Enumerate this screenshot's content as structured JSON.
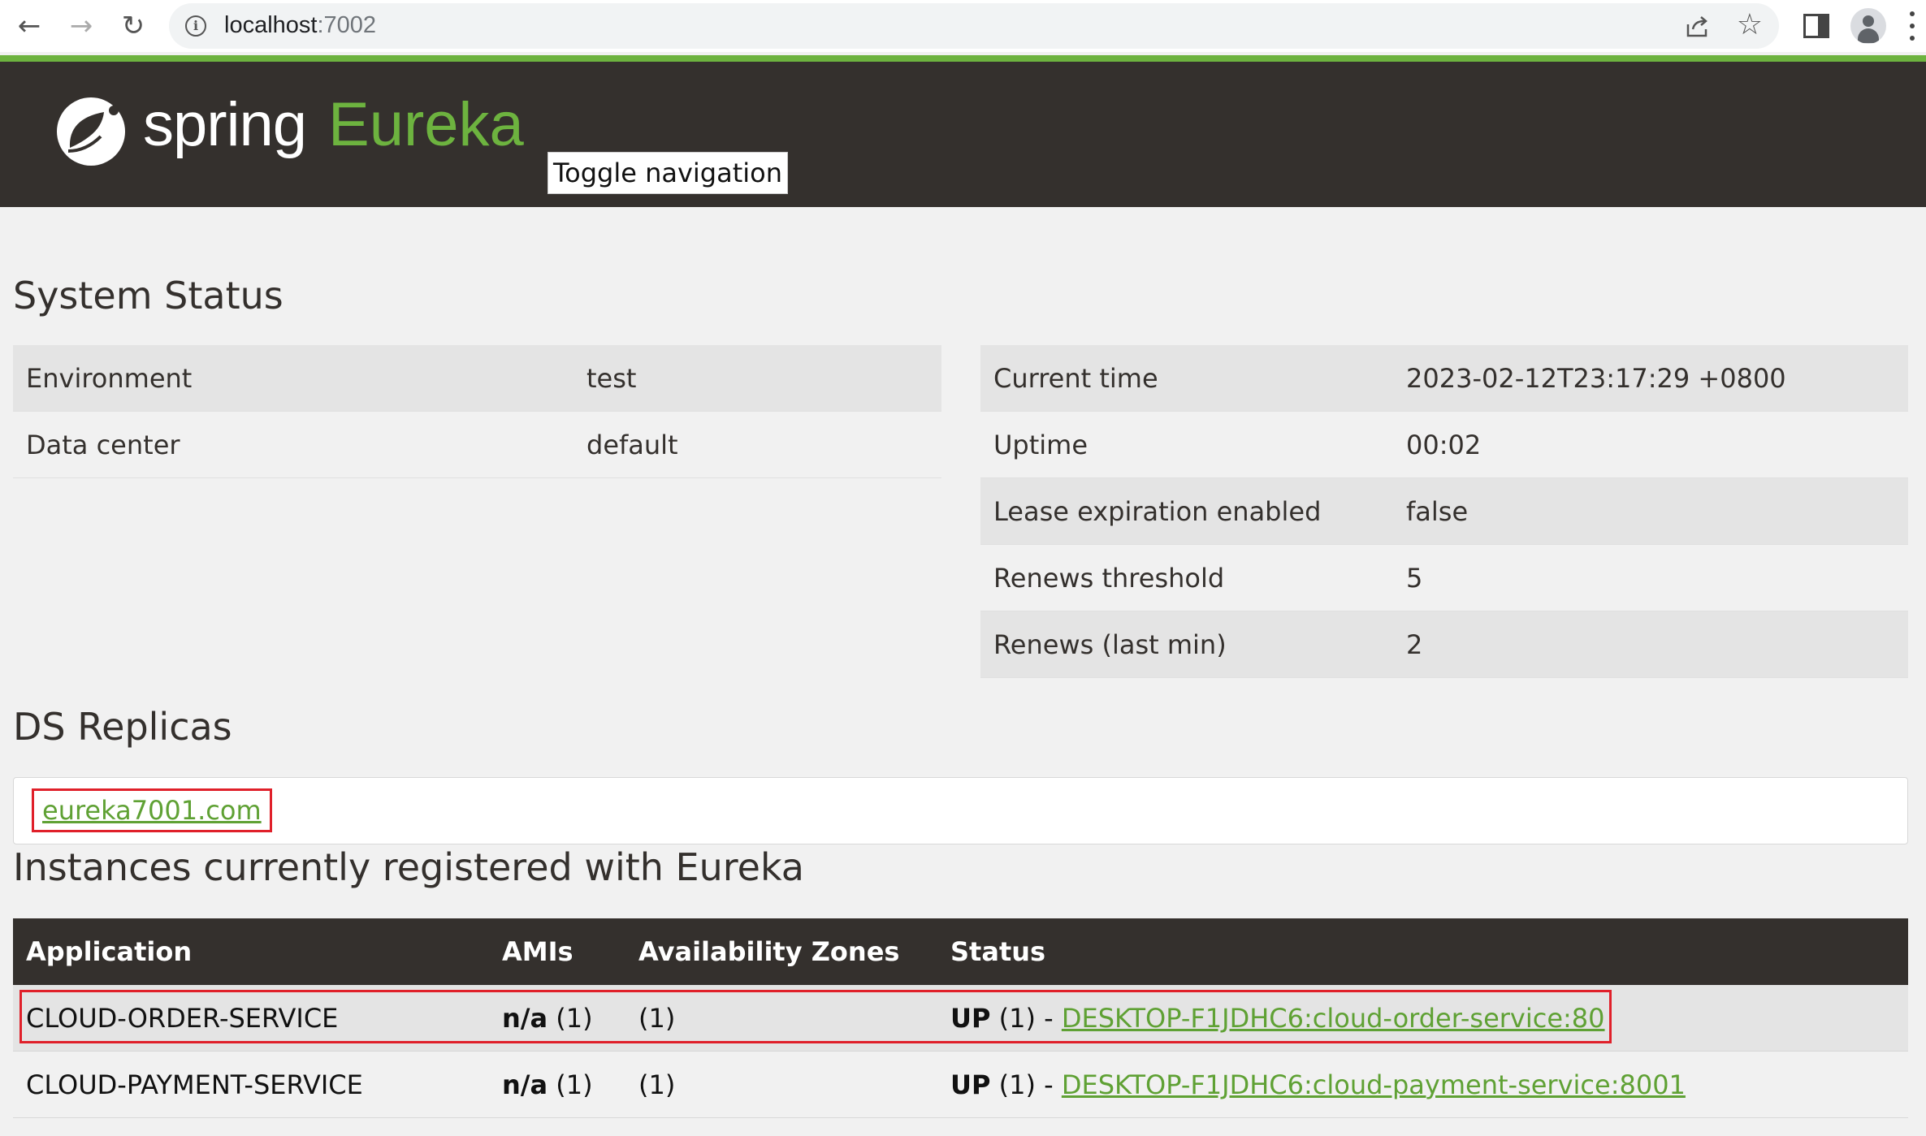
{
  "browser": {
    "url_host": "localhost",
    "url_port": ":7002"
  },
  "header": {
    "brand_spring": "spring",
    "brand_eureka": "Eureka",
    "toggle_nav": "Toggle navigation"
  },
  "system_status": {
    "title": "System Status",
    "left": [
      {
        "label": "Environment",
        "value": "test"
      },
      {
        "label": "Data center",
        "value": "default"
      }
    ],
    "right": [
      {
        "label": "Current time",
        "value": "2023-02-12T23:17:29 +0800"
      },
      {
        "label": "Uptime",
        "value": "00:02"
      },
      {
        "label": "Lease expiration enabled",
        "value": "false"
      },
      {
        "label": "Renews threshold",
        "value": "5"
      },
      {
        "label": "Renews (last min)",
        "value": "2"
      }
    ]
  },
  "ds_replicas": {
    "title": "DS Replicas",
    "link": "eureka7001.com"
  },
  "instances": {
    "title": "Instances currently registered with Eureka",
    "headers": [
      "Application",
      "AMIs",
      "Availability Zones",
      "Status"
    ],
    "rows": [
      {
        "app": "CLOUD-ORDER-SERVICE",
        "amis_label": "n/a",
        "amis_count": "(1)",
        "zones": "(1)",
        "status_up": "UP",
        "status_count": "(1) -",
        "instance": "DESKTOP-F1JDHC6:cloud-order-service:80"
      },
      {
        "app": "CLOUD-PAYMENT-SERVICE",
        "amis_label": "n/a",
        "amis_count": "(1)",
        "zones": "(1)",
        "status_up": "UP",
        "status_count": "(1) -",
        "instance": "DESKTOP-F1JDHC6:cloud-payment-service:8001"
      }
    ]
  },
  "colors": {
    "spring_green": "#6db33f",
    "header_dark": "#34302d",
    "highlight_red": "#e0202a"
  }
}
